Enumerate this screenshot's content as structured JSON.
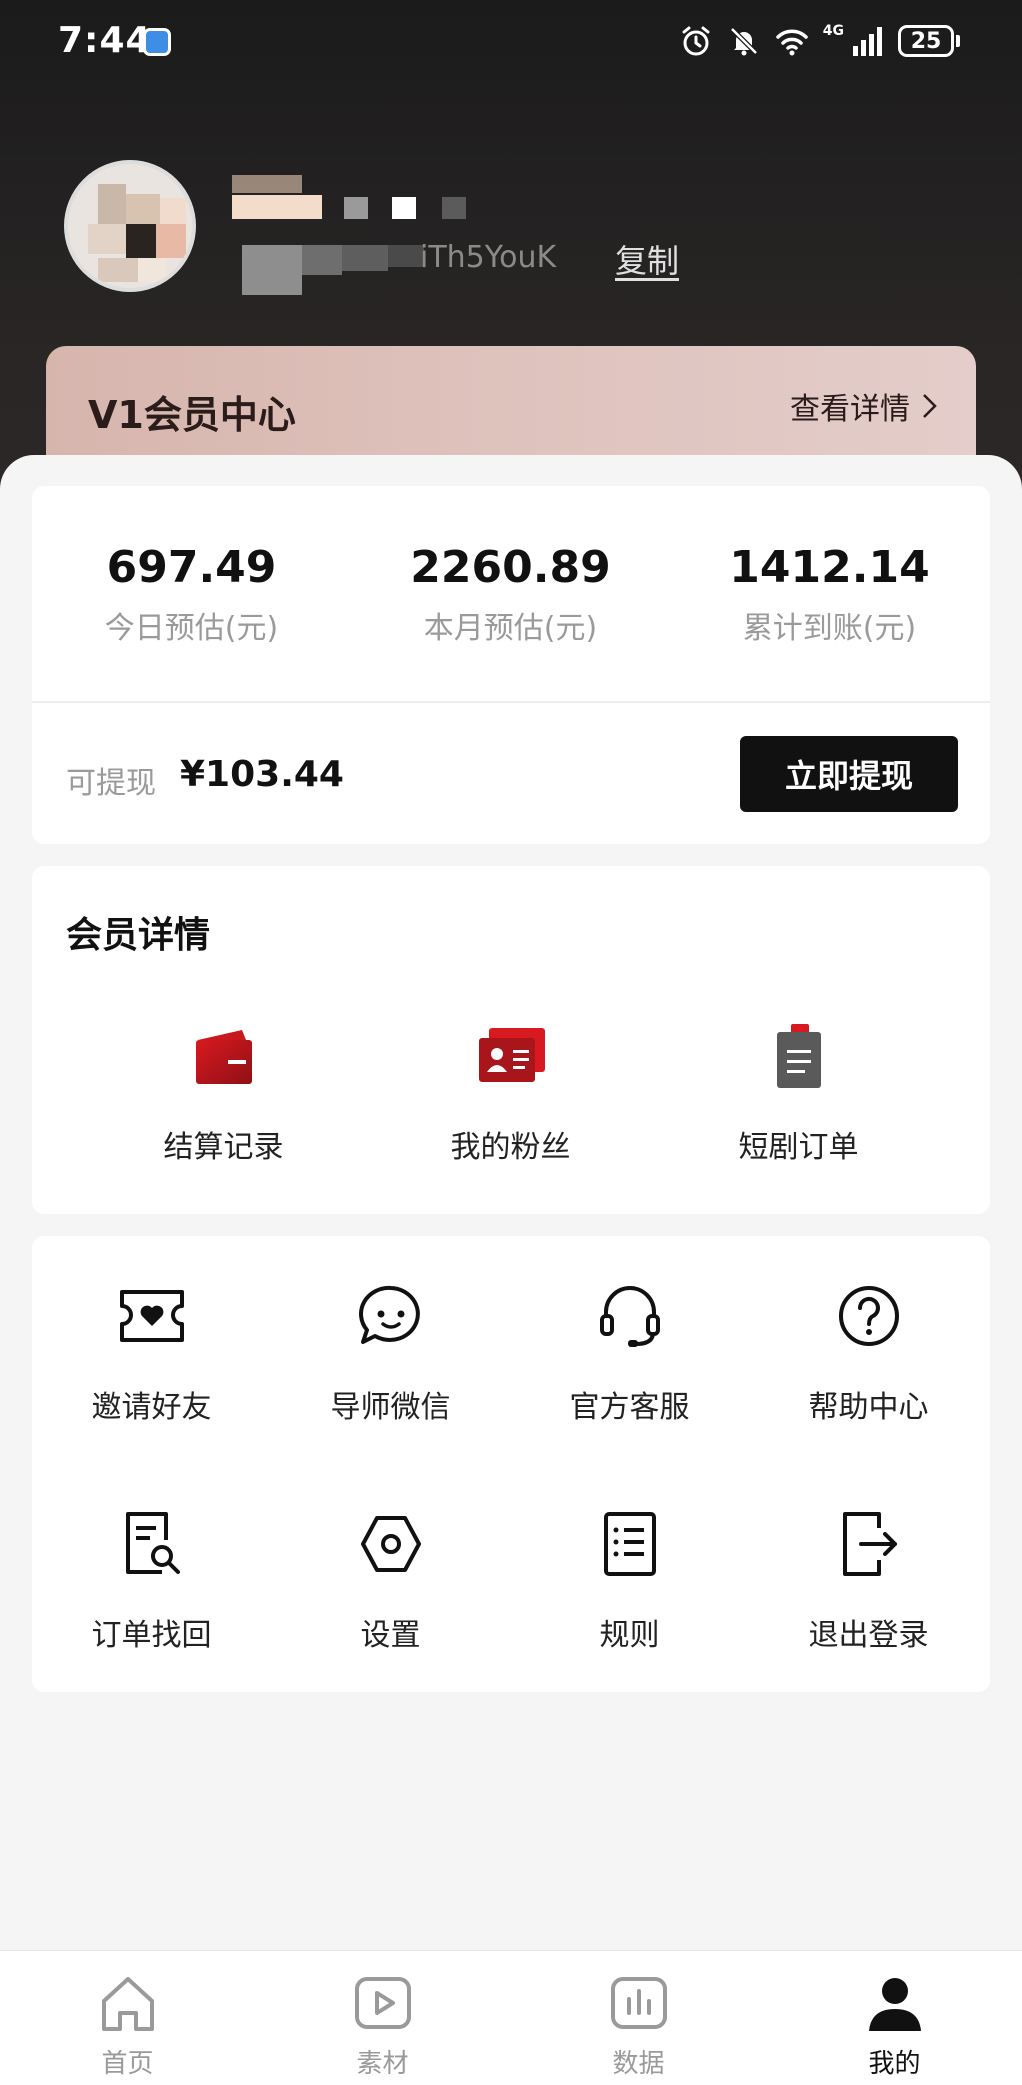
{
  "status_bar": {
    "time": "7:44",
    "network_label": "4G",
    "battery": "25",
    "icons": [
      "alarm-icon",
      "mute-bell-icon",
      "wifi-icon",
      "signal-icon",
      "battery-icon"
    ]
  },
  "profile": {
    "uid_partial": "iTh5YouK",
    "copy_label": "复制"
  },
  "vip": {
    "title": "V1会员中心",
    "detail_label": "查看详情"
  },
  "stats": [
    {
      "value": "697.49",
      "label": "今日预估(元)"
    },
    {
      "value": "2260.89",
      "label": "本月预估(元)"
    },
    {
      "value": "1412.14",
      "label": "累计到账(元)"
    }
  ],
  "withdraw": {
    "label": "可提现",
    "amount": "¥103.44",
    "button": "立即提现"
  },
  "member_details": {
    "title": "会员详情",
    "items": [
      {
        "label": "结算记录",
        "icon": "wallet-icon"
      },
      {
        "label": "我的粉丝",
        "icon": "id-card-icon"
      },
      {
        "label": "短剧订单",
        "icon": "clipboard-icon"
      }
    ]
  },
  "tools": [
    {
      "label": "邀请好友",
      "icon": "ticket-heart-icon"
    },
    {
      "label": "导师微信",
      "icon": "chat-bubble-icon"
    },
    {
      "label": "官方客服",
      "icon": "headset-icon"
    },
    {
      "label": "帮助中心",
      "icon": "help-circle-icon"
    },
    {
      "label": "订单找回",
      "icon": "document-search-icon"
    },
    {
      "label": "设置",
      "icon": "hexagon-settings-icon"
    },
    {
      "label": "规则",
      "icon": "list-document-icon"
    },
    {
      "label": "退出登录",
      "icon": "logout-icon"
    }
  ],
  "tab_bar": {
    "tabs": [
      {
        "label": "首页",
        "icon": "home-icon",
        "active": false
      },
      {
        "label": "素材",
        "icon": "play-icon",
        "active": false
      },
      {
        "label": "数据",
        "icon": "bar-chart-icon",
        "active": false
      },
      {
        "label": "我的",
        "icon": "profile-icon",
        "active": true
      }
    ]
  },
  "colors": {
    "header_bg": "#1b1b1b",
    "vip_card": "#d6b5ad",
    "accent_red": "#c8191e",
    "button_dark": "#111111"
  }
}
